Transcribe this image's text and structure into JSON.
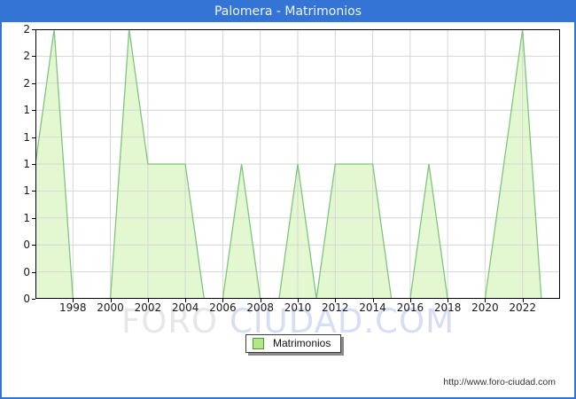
{
  "window": {
    "title": "Palomera - Matrimonios"
  },
  "watermark": {
    "part1": "FORO ",
    "part2": "CIUDAD.COM"
  },
  "legend": {
    "label": "Matrimonios"
  },
  "footer": {
    "url": "http://www.foro-ciudad.com"
  },
  "colors": {
    "frame_blue": "#3474d4",
    "title_text": "#f0f4fc",
    "plot_border": "#000000",
    "gridline": "#d6d6d6",
    "area_fill": "#e3f8d0",
    "area_line": "#7fc57f",
    "legend_swatch_fill": "#b2e686",
    "legend_swatch_border": "#549a34",
    "axis_text": "#1a1a1a",
    "watermark_gray": "#e7e7e7",
    "watermark_blue": "#d6def4"
  },
  "chart_data": {
    "type": "area",
    "title": "Palomera - Matrimonios",
    "series_name": "Matrimonios",
    "x": [
      1996,
      1997,
      1998,
      1999,
      2000,
      2001,
      2002,
      2003,
      2004,
      2005,
      2006,
      2007,
      2008,
      2009,
      2010,
      2011,
      2012,
      2013,
      2014,
      2015,
      2016,
      2017,
      2018,
      2019,
      2020,
      2021,
      2022,
      2023
    ],
    "values": [
      1,
      2,
      0,
      0,
      0,
      2,
      1,
      1,
      1,
      0,
      0,
      1,
      0,
      0,
      1,
      0,
      1,
      1,
      1,
      0,
      0,
      1,
      0,
      0,
      0,
      1,
      2,
      0
    ],
    "x_range": [
      1996,
      2024
    ],
    "ylim": [
      0,
      2
    ],
    "y_tick_labels": [
      "2",
      "2",
      "2",
      "1",
      "1",
      "1",
      "1",
      "1",
      "0",
      "0",
      "0"
    ],
    "x_tick_labels": [
      "1998",
      "2000",
      "2002",
      "2004",
      "2006",
      "2008",
      "2010",
      "2012",
      "2014",
      "2016",
      "2018",
      "2020",
      "2022"
    ],
    "grid": true,
    "legend_position": "bottom-center"
  }
}
